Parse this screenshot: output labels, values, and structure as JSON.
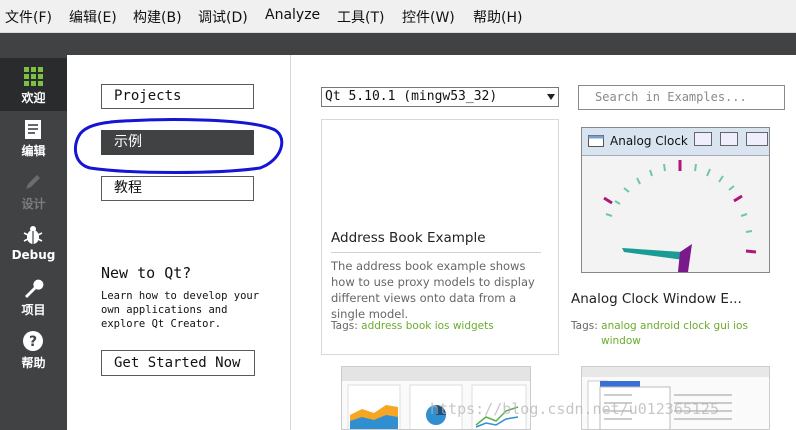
{
  "menu": [
    "文件(F)",
    "编辑(E)",
    "构建(B)",
    "调试(D)",
    "Analyze",
    "工具(T)",
    "控件(W)",
    "帮助(H)"
  ],
  "modes": [
    {
      "label": "欢迎",
      "icon": "grid-icon"
    },
    {
      "label": "编辑",
      "icon": "document-icon"
    },
    {
      "label": "设计",
      "icon": "pencil-icon"
    },
    {
      "label": "Debug",
      "icon": "bug-icon"
    },
    {
      "label": "项目",
      "icon": "wrench-icon"
    },
    {
      "label": "帮助",
      "icon": "help-icon"
    }
  ],
  "nav": {
    "projects": "Projects",
    "examples": "示例",
    "tutorials": "教程"
  },
  "newqt": {
    "title": "New to Qt?",
    "text": "Learn how to develop your own applications and explore Qt Creator.",
    "button": "Get Started Now"
  },
  "kit_select": "Qt 5.10.1 (mingw53_32)",
  "search_placeholder": "Search in Examples...",
  "examples": [
    {
      "title": "Address Book Example",
      "description": "The address book example shows how to use proxy models to display different views onto data from a single model.",
      "tags_label": "Tags:",
      "tags": [
        "address",
        "book",
        "ios",
        "widgets"
      ]
    },
    {
      "title": "Analog Clock Window E...",
      "tags_label": "Tags:",
      "tags": [
        "analog",
        "android",
        "clock",
        "gui",
        "ios",
        "window"
      ],
      "thumbnail_title": "Analog Clock"
    }
  ],
  "watermark": "https://blog.csdn.net/u012365125",
  "colors": {
    "sidebar": "#404244",
    "tag": "#6aac2c",
    "annotation": "#1515d6"
  }
}
